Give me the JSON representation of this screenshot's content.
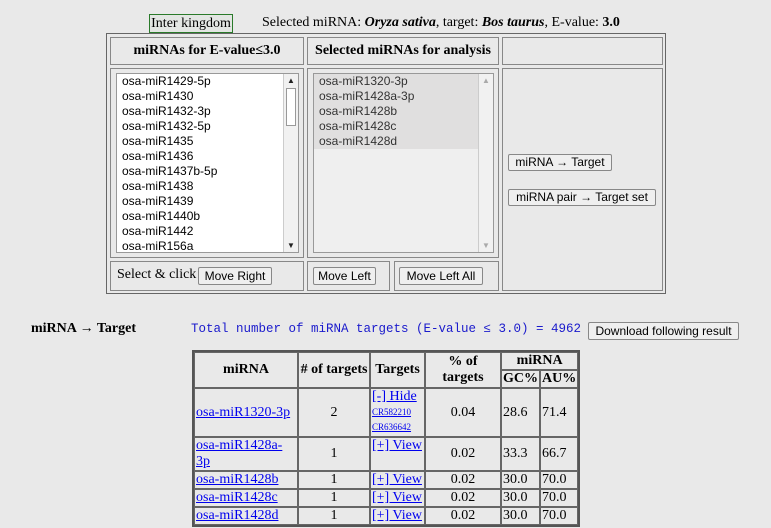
{
  "header": {
    "mode_button": "Inter kingdom",
    "selected_prefix": "Selected miRNA:",
    "species": "Oryza sativa",
    "target_prefix": ", target:",
    "target": "Bos taurus",
    "evalue_prefix": ", E-value:",
    "evalue": "3.0"
  },
  "panel": {
    "col1_header": "miRNAs for E-value≤3.0",
    "col2_header": "Selected miRNAs for analysis",
    "available_mirnas": [
      "osa-miR1429-5p",
      "osa-miR1430",
      "osa-miR1432-3p",
      "osa-miR1432-5p",
      "osa-miR1435",
      "osa-miR1436",
      "osa-miR1437b-5p",
      "osa-miR1438",
      "osa-miR1439",
      "osa-miR1440b",
      "osa-miR1442",
      "osa-miR156a"
    ],
    "selected_mirnas": [
      "osa-miR1320-3p",
      "osa-miR1428a-3p",
      "osa-miR1428b",
      "osa-miR1428c",
      "osa-miR1428d"
    ],
    "select_hint": "Select & click",
    "move_right": "Move Right",
    "move_left": "Move Left",
    "move_left_all": "Move Left All",
    "mirna_target_button": "miRNA → Target",
    "mirna_pair_button": "miRNA pair → Target set"
  },
  "result": {
    "section_title": "miRNA → Target",
    "total_line": "Total number of miRNA targets (E-value ≤ 3.0) = 4962",
    "download_button": "Download following result",
    "columns": {
      "mirna": "miRNA",
      "num_targets": "# of targets",
      "targets": "Targets",
      "pct_targets": "% of targets",
      "mirna_group": "miRNA",
      "gc": "GC%",
      "au": "AU%"
    },
    "rows": [
      {
        "mirna": "osa-miR1320-3p",
        "num": "2",
        "toggle": "[-] Hide",
        "targets": [
          "CR582210",
          "CR636642"
        ],
        "pct": "0.04",
        "gc": "28.6",
        "au": "71.4"
      },
      {
        "mirna": "osa-miR1428a-3p",
        "num": "1",
        "toggle": "[+] View",
        "targets": [],
        "pct": "0.02",
        "gc": "33.3",
        "au": "66.7"
      },
      {
        "mirna": "osa-miR1428b",
        "num": "1",
        "toggle": "[+] View",
        "targets": [],
        "pct": "0.02",
        "gc": "30.0",
        "au": "70.0"
      },
      {
        "mirna": "osa-miR1428c",
        "num": "1",
        "toggle": "[+] View",
        "targets": [],
        "pct": "0.02",
        "gc": "30.0",
        "au": "70.0"
      },
      {
        "mirna": "osa-miR1428d",
        "num": "1",
        "toggle": "[+] View",
        "targets": [],
        "pct": "0.02",
        "gc": "30.0",
        "au": "70.0"
      }
    ]
  }
}
